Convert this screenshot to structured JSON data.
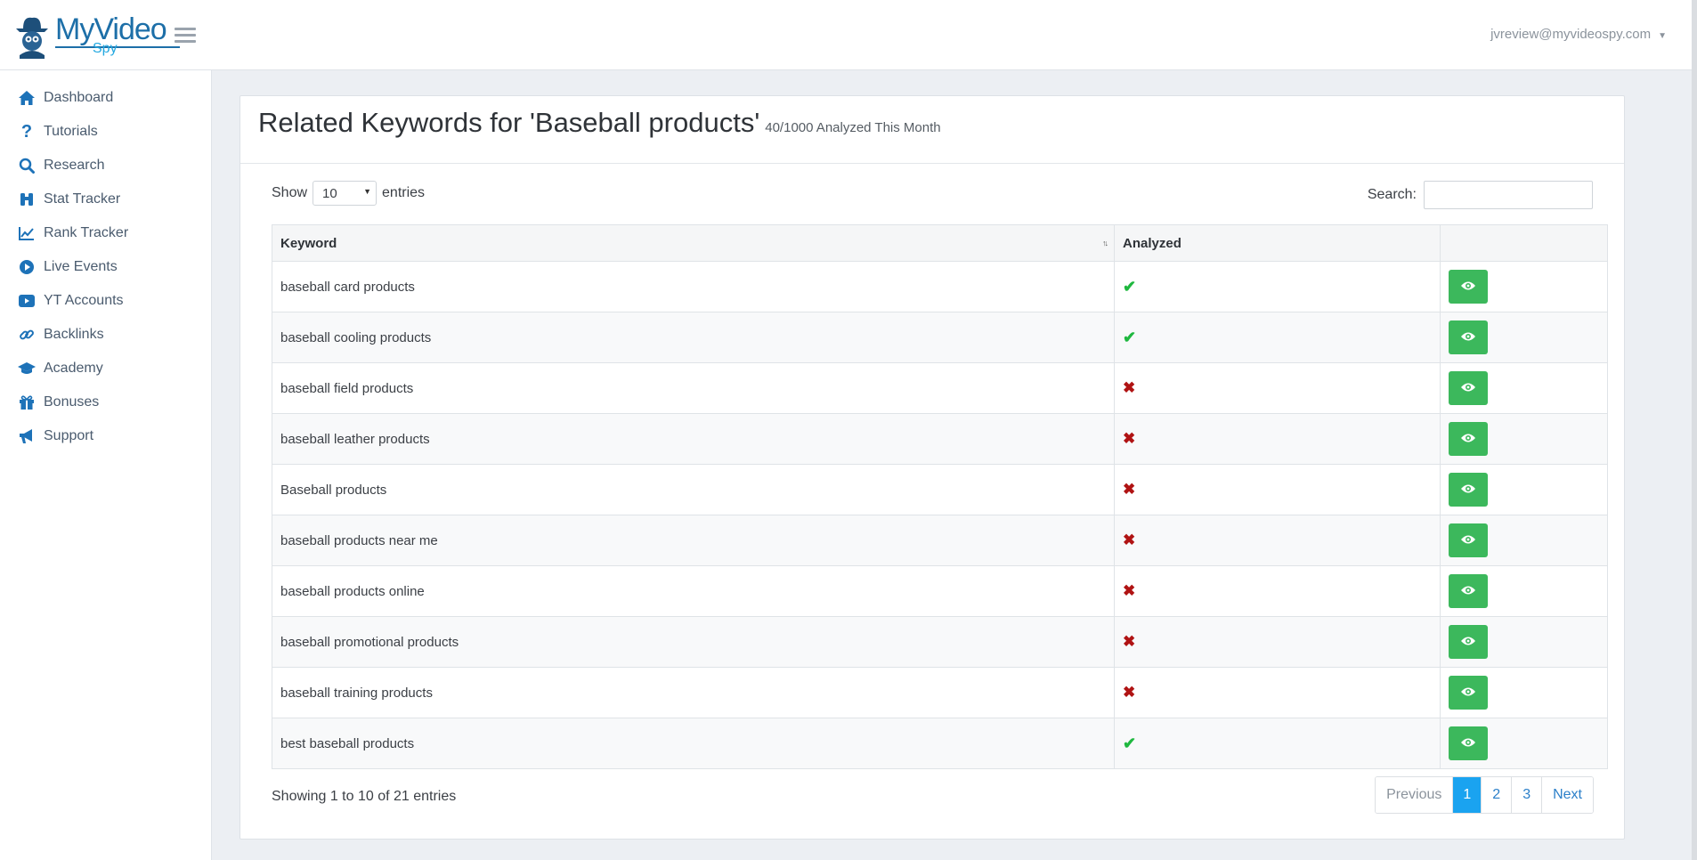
{
  "header": {
    "logo_main": "MyVideo",
    "logo_sub": "Spy",
    "user_email": "jvreview@myvideospy.com"
  },
  "sidebar": {
    "items": [
      {
        "label": "Dashboard",
        "icon": "home-icon"
      },
      {
        "label": "Tutorials",
        "icon": "question-icon"
      },
      {
        "label": "Research",
        "icon": "search-icon"
      },
      {
        "label": "Stat Tracker",
        "icon": "binoculars-icon"
      },
      {
        "label": "Rank Tracker",
        "icon": "line-chart-icon"
      },
      {
        "label": "Live Events",
        "icon": "play-circle-icon"
      },
      {
        "label": "YT Accounts",
        "icon": "youtube-icon"
      },
      {
        "label": "Backlinks",
        "icon": "link-icon"
      },
      {
        "label": "Academy",
        "icon": "graduation-cap-icon"
      },
      {
        "label": "Bonuses",
        "icon": "gift-icon"
      },
      {
        "label": "Support",
        "icon": "megaphone-icon"
      }
    ]
  },
  "main": {
    "title": "Related Keywords for 'Baseball products'",
    "subtitle": "40/1000 Analyzed This Month",
    "show_label": "Show",
    "entries_value": "10",
    "entries_label": "entries",
    "search_label": "Search:",
    "search_value": "",
    "columns": [
      "Keyword",
      "Analyzed",
      ""
    ],
    "rows": [
      {
        "keyword": "baseball card products",
        "analyzed": true
      },
      {
        "keyword": "baseball cooling products",
        "analyzed": true
      },
      {
        "keyword": "baseball field products",
        "analyzed": false
      },
      {
        "keyword": "baseball leather products",
        "analyzed": false
      },
      {
        "keyword": "Baseball products",
        "analyzed": false
      },
      {
        "keyword": "baseball products near me",
        "analyzed": false
      },
      {
        "keyword": "baseball products online",
        "analyzed": false
      },
      {
        "keyword": "baseball promotional products",
        "analyzed": false
      },
      {
        "keyword": "baseball training products",
        "analyzed": false
      },
      {
        "keyword": "best baseball products",
        "analyzed": true
      }
    ],
    "info": "Showing 1 to 10 of 21 entries",
    "pagination": {
      "previous": "Previous",
      "pages": [
        "1",
        "2",
        "3"
      ],
      "active": "1",
      "next": "Next"
    }
  },
  "colors": {
    "accent_blue": "#1aa3f0",
    "logo_blue": "#1d6fa8",
    "button_green": "#3cb85c",
    "check_green": "#1fb83f",
    "cross_red": "#b01313"
  }
}
